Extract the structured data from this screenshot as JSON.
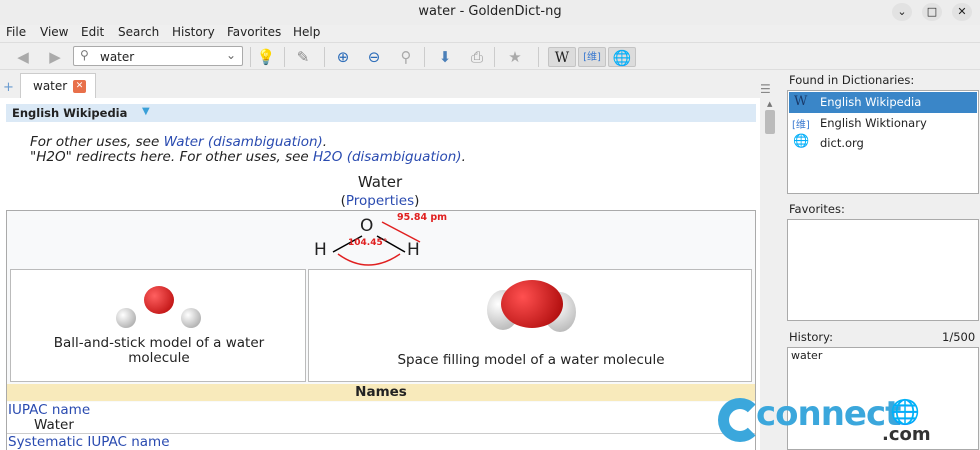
{
  "window": {
    "title": "water - GoldenDict-ng"
  },
  "menu": [
    "File",
    "View",
    "Edit",
    "Search",
    "History",
    "Favorites",
    "Help"
  ],
  "toolbar": {
    "search_value": "water"
  },
  "tab": {
    "label": "water"
  },
  "article": {
    "dict_name": "English Wikipedia",
    "hatnote1_pre": "For other uses, see ",
    "hatnote1_link": "Water (disambiguation)",
    "hatnote1_post": ".",
    "hatnote2_pre": "\"H2O\" redirects here. For other uses, see ",
    "hatnote2_link": "H2O (disambiguation)",
    "hatnote2_post": ".",
    "infobox_title": "Water",
    "properties_open": "(",
    "properties_link": "Properties",
    "properties_close": ")",
    "diagram": {
      "o": "O",
      "h": "H",
      "bond_length": "95.84 pm",
      "angle": "104.45°"
    },
    "ball_caption": "Ball-and-stick model of a water molecule",
    "space_caption": "Space filling model of a water molecule",
    "names_header": "Names",
    "iupac_label": "IUPAC name",
    "iupac_value": "Water",
    "systematic_label": "Systematic IUPAC name"
  },
  "sidebar": {
    "found_label": "Found in Dictionaries:",
    "dictionaries": [
      {
        "label": "English Wikipedia",
        "icon": "W"
      },
      {
        "label": "English Wiktionary",
        "icon": "[维]"
      },
      {
        "label": "dict.org",
        "icon": "globe"
      }
    ],
    "favorites_label": "Favorites:",
    "history_label": "History:",
    "history_count": "1/500",
    "history_items": [
      "water"
    ]
  },
  "watermark": {
    "text": "connect",
    "suffix": ".com"
  },
  "colors": {
    "selection": "#3a86c8",
    "header_bg": "#dbe9f6",
    "names_bg": "#f8eabb",
    "link": "#2a4bb0",
    "watermark": "#3ba7dc"
  }
}
